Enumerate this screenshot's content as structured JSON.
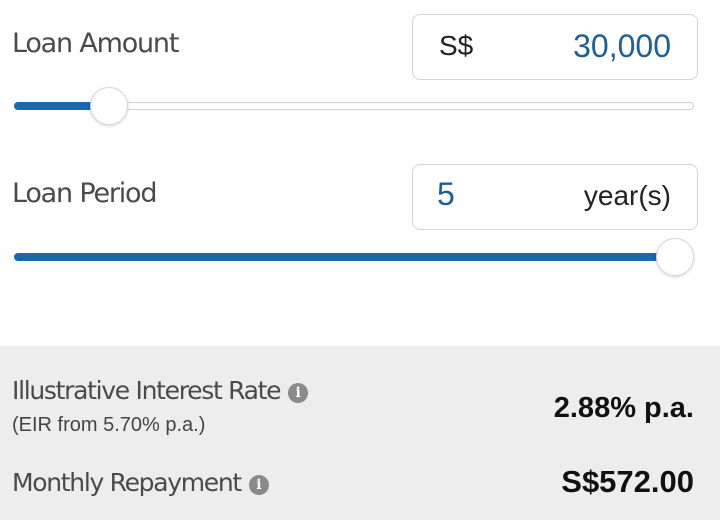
{
  "loan_amount": {
    "label": "Loan Amount",
    "currency": "S$",
    "value": "30,000",
    "slider_fraction": 0.118
  },
  "loan_period": {
    "label": "Loan Period",
    "value": "5",
    "unit": "year(s)",
    "slider_fraction": 1.0
  },
  "results": {
    "interest_label": "Illustrative Interest Rate",
    "interest_sub": "(EIR from 5.70% p.a.)",
    "interest_value": "2.88% p.a.",
    "repayment_label": "Monthly Repayment",
    "repayment_value": "S$572.00",
    "info_glyph": "i"
  },
  "colors": {
    "accent": "#1c68ad",
    "value_text": "#1d5f98",
    "results_bg": "#ededed"
  }
}
